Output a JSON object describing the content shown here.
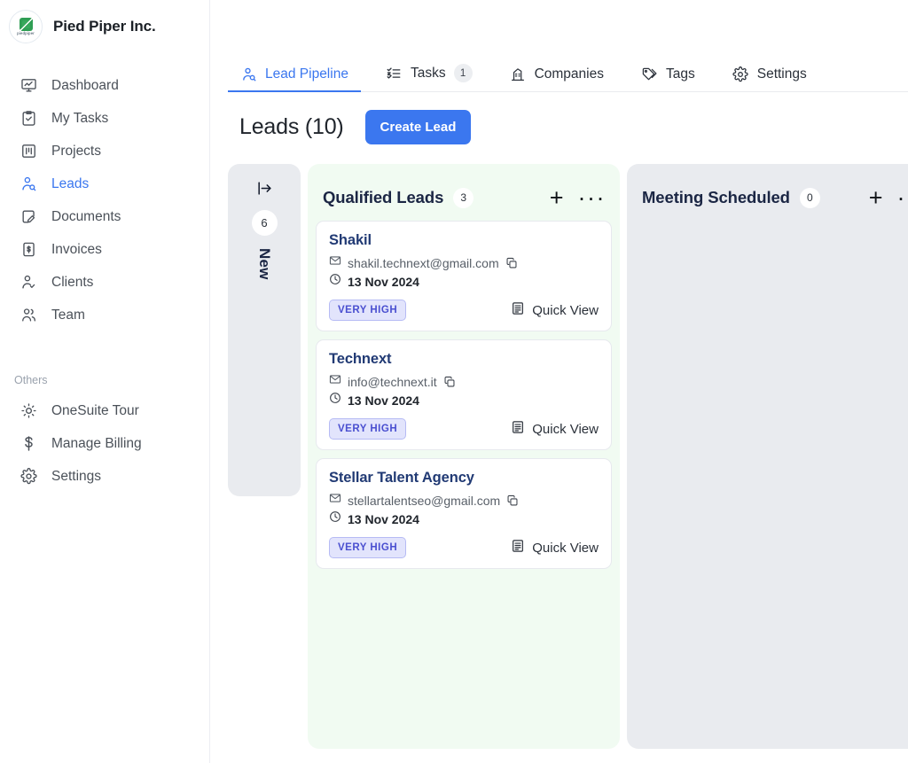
{
  "sidebar": {
    "brand": {
      "name": "Pied Piper Inc.",
      "logo_text": "piedpiper",
      "logo_color": "#2f9e54"
    },
    "items": [
      {
        "label": "Dashboard",
        "icon": "dashboard-monitor-icon",
        "active": false
      },
      {
        "label": "My Tasks",
        "icon": "clipboard-check-icon",
        "active": false
      },
      {
        "label": "Projects",
        "icon": "kanban-board-icon",
        "active": false
      },
      {
        "label": "Leads",
        "icon": "user-search-icon",
        "active": true
      },
      {
        "label": "Documents",
        "icon": "document-edit-icon",
        "active": false
      },
      {
        "label": "Invoices",
        "icon": "invoice-dollar-icon",
        "active": false
      },
      {
        "label": "Clients",
        "icon": "user-check-icon",
        "active": false
      },
      {
        "label": "Team",
        "icon": "users-group-icon",
        "active": false
      }
    ],
    "others_label": "Others",
    "others": [
      {
        "label": "OneSuite Tour",
        "icon": "sun-tour-icon"
      },
      {
        "label": "Manage Billing",
        "icon": "dollar-sign-icon"
      },
      {
        "label": "Settings",
        "icon": "gear-icon"
      }
    ],
    "active_color": "#3b77ef"
  },
  "tabs": [
    {
      "label": "Lead Pipeline",
      "icon": "user-search-icon",
      "badge": null,
      "active": true
    },
    {
      "label": "Tasks",
      "icon": "checklist-icon",
      "badge": "1",
      "active": false
    },
    {
      "label": "Companies",
      "icon": "building-icon",
      "badge": null,
      "active": false
    },
    {
      "label": "Tags",
      "icon": "tags-icon",
      "badge": null,
      "active": false
    },
    {
      "label": "Settings",
      "icon": "gear-icon",
      "badge": null,
      "active": false
    }
  ],
  "page": {
    "title": "Leads  (10)",
    "create_button": "Create Lead",
    "accent_color": "#3b77ef"
  },
  "board": {
    "collapsed_column": {
      "title": "New",
      "count": "6",
      "expand_icon": "expand-right-icon"
    },
    "columns": [
      {
        "title": "Qualified Leads",
        "count": "3",
        "color": "#f1fbf2",
        "add_icon": "plus-icon",
        "more_icon": "more-horizontal-icon",
        "cards": [
          {
            "name": "Shakil",
            "email": "shakil.technext@gmail.com",
            "date": "13 Nov 2024",
            "priority": "VERY HIGH",
            "quick_view": "Quick View"
          },
          {
            "name": "Technext",
            "email": "info@technext.it",
            "date": "13 Nov 2024",
            "priority": "VERY HIGH",
            "quick_view": "Quick View"
          },
          {
            "name": "Stellar Talent Agency",
            "email": "stellartalentseo@gmail.com",
            "date": "13 Nov 2024",
            "priority": "VERY HIGH",
            "quick_view": "Quick View"
          }
        ]
      },
      {
        "title": "Meeting Scheduled",
        "count": "0",
        "color": "#e9ebef",
        "add_icon": "plus-icon",
        "more_icon": "more-horizontal-icon",
        "cards": []
      }
    ]
  }
}
